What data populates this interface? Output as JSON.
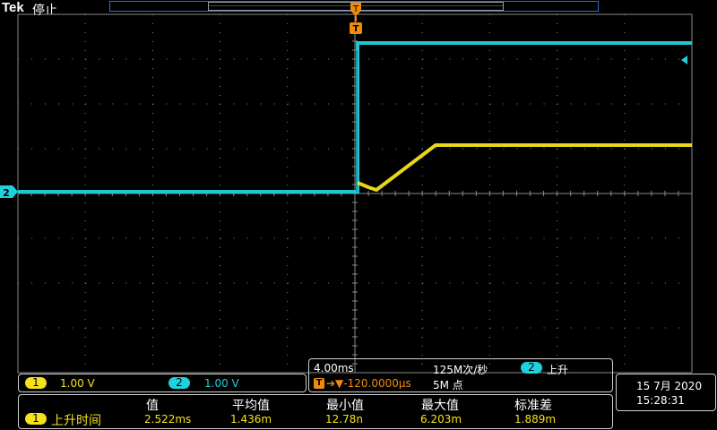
{
  "header": {
    "brand": "Tek",
    "state": "停止"
  },
  "trigger": {
    "marker_label": "T"
  },
  "channels": [
    {
      "id": "1",
      "scale": "1.00 V",
      "color": "#f4e21c"
    },
    {
      "id": "2",
      "scale": "1.00 V",
      "color": "#1fd1dd"
    }
  ],
  "ch2_ground_label": "2",
  "horizontal": {
    "scale": "4.00ms",
    "sample_rate": "125M次/秒",
    "trigger_source": "2",
    "trigger_slope": "上升",
    "trigger_icon": "T",
    "delay": "➔▼-120.0000μs",
    "record_length": "5M 点"
  },
  "datetime": {
    "date": "15 7月 2020",
    "time": "15:28:31"
  },
  "measurement": {
    "headers": [
      "值",
      "平均值",
      "最小值",
      "最大值",
      "标准差"
    ],
    "row": {
      "source": "1",
      "name": "上升时间",
      "values": [
        "2.522ms",
        "1.436m",
        "12.78n",
        "6.203m",
        "1.889m"
      ]
    }
  },
  "colors": {
    "ch1": "#f4e21c",
    "ch2": "#1fd1dd",
    "grid": "#8a8a8a",
    "panel_border": "#cfcfcf",
    "trigger": "#f08a0a"
  }
}
